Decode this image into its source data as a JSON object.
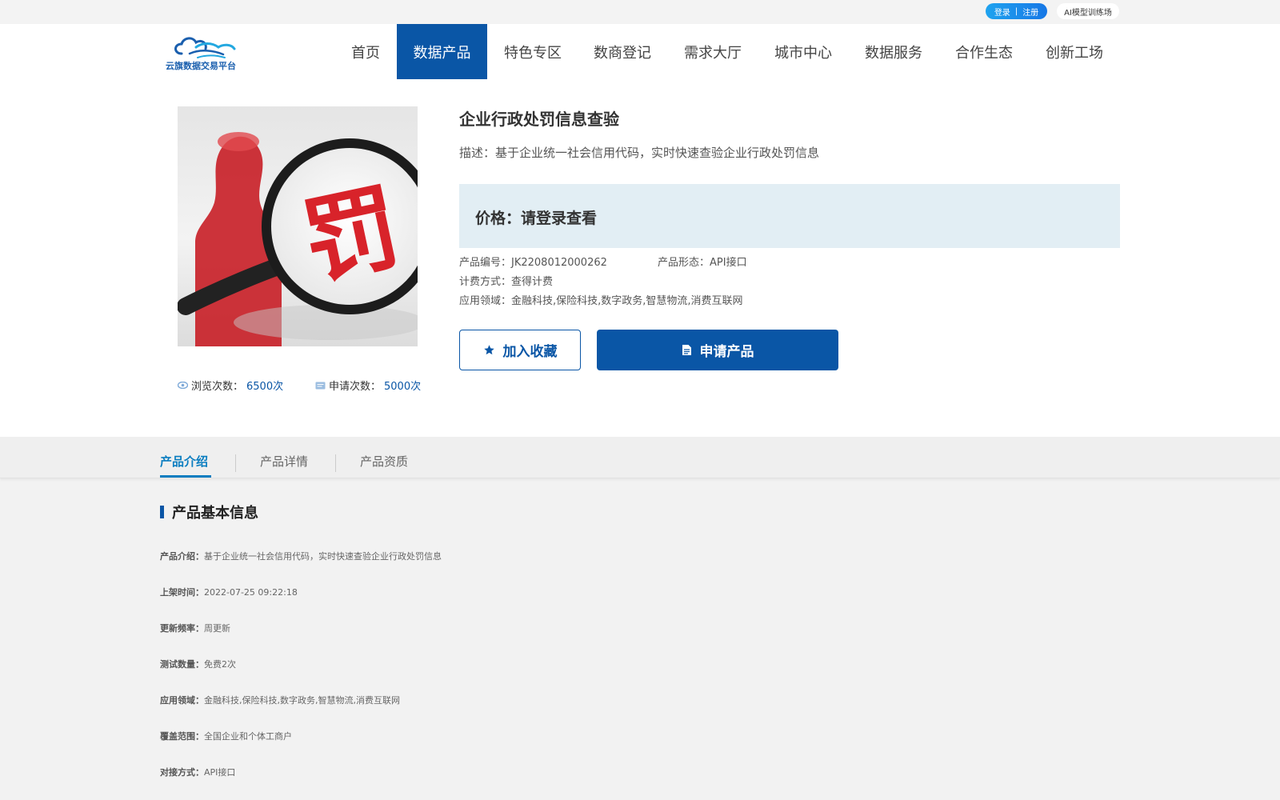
{
  "topbar": {
    "login": "登录",
    "separator": "|",
    "register": "注册",
    "ai_training": "AI模型训练场"
  },
  "logo": {
    "text": "云旗数据交易平台"
  },
  "nav": {
    "items": [
      {
        "label": "首页"
      },
      {
        "label": "数据产品"
      },
      {
        "label": "特色专区"
      },
      {
        "label": "数商登记"
      },
      {
        "label": "需求大厅"
      },
      {
        "label": "城市中心"
      },
      {
        "label": "数据服务"
      },
      {
        "label": "合作生态"
      },
      {
        "label": "创新工场"
      }
    ],
    "active_index": 1
  },
  "product": {
    "image_glyph": "罚",
    "title": "企业行政处罚信息查验",
    "description": "描述：基于企业统一社会信用代码，实时快速查验企业行政处罚信息",
    "price": "价格：请登录查看",
    "product_id": "产品编号：JK2208012000262",
    "product_form": "产品形态：API接口",
    "billing": "计费方式：查得计费",
    "domains": "应用领域：金融科技,保险科技,数字政务,智慧物流,消费互联网",
    "views_label": "浏览次数：",
    "views_value": "6500次",
    "applies_label": "申请次数：",
    "applies_value": "5000次",
    "fav_button": "加入收藏",
    "apply_button": "申请产品"
  },
  "tabs": [
    {
      "label": "产品介绍"
    },
    {
      "label": "产品详情"
    },
    {
      "label": "产品资质"
    }
  ],
  "basic_info": {
    "title": "产品基本信息",
    "rows": [
      {
        "key": "产品介绍：",
        "value": "基于企业统一社会信用代码，实时快速查验企业行政处罚信息"
      },
      {
        "key": "上架时间：",
        "value": "2022-07-25 09:22:18"
      },
      {
        "key": "更新频率：",
        "value": "周更新"
      },
      {
        "key": "测试数量：",
        "value": "免费2次"
      },
      {
        "key": "应用领域：",
        "value": "金融科技,保险科技,数字政务,智慧物流,消费互联网"
      },
      {
        "key": "覆盖范围：",
        "value": "全国企业和个体工商户"
      },
      {
        "key": "对接方式：",
        "value": "API接口"
      }
    ]
  },
  "colors": {
    "primary": "#0a56a6",
    "accent": "#0a7dc0",
    "price_bg": "#e2eef4",
    "stamp_red": "#d8232a"
  }
}
